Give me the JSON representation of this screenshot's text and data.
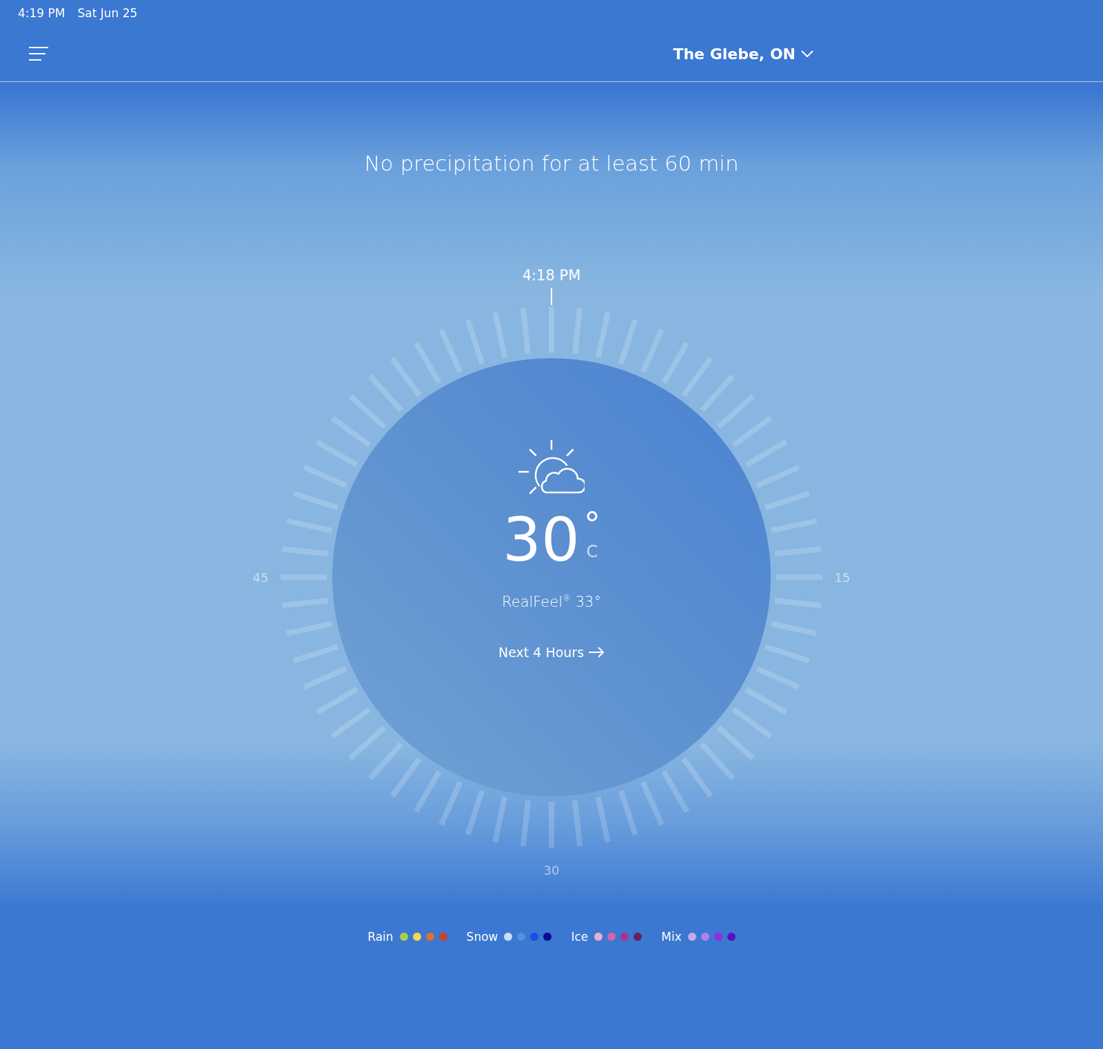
{
  "status_bar": {
    "time": "4:19 PM",
    "date": "Sat Jun 25"
  },
  "header": {
    "location": "The Glebe, ON"
  },
  "message": "No precipitation for at least 60 min",
  "dial": {
    "top_label": "4:18 PM",
    "left_label": "45",
    "right_label": "15",
    "bottom_label": "30"
  },
  "current": {
    "temperature": "30",
    "degree": "°",
    "unit": "C",
    "realfeel": "RealFeel$^{®}$ 33°",
    "link": "Next 4 Hours"
  },
  "legend": [
    {
      "label": "Rain",
      "dots": [
        {
          "color": "#a7cf4f"
        },
        {
          "color": "#f5d84f"
        },
        {
          "color": "#e07030"
        },
        {
          "color": "#c9442a"
        }
      ]
    },
    {
      "label": "Snow",
      "dots": [
        {
          "color": "#c8dcf8"
        },
        {
          "color": "#4a95e0"
        },
        {
          "color": "#1a4de0"
        },
        {
          "color": "#0a0a99"
        }
      ]
    },
    {
      "label": "Ice",
      "dots": [
        {
          "color": "#e8aed0"
        },
        {
          "color": "#d068a8"
        },
        {
          "color": "#b03090"
        },
        {
          "color": "#6a2060"
        }
      ]
    },
    {
      "label": "Mix",
      "dots": [
        {
          "color": "#c8a8ec"
        },
        {
          "color": "#b080e8"
        },
        {
          "color": "#8a30e0"
        },
        {
          "color": "#5a10c0"
        }
      ]
    }
  ]
}
